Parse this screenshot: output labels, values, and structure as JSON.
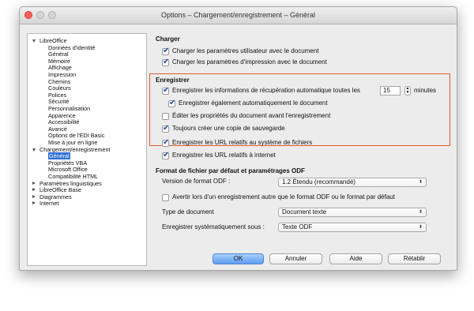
{
  "window": {
    "title": "Options – Chargement/enregistrement – Général"
  },
  "tree": [
    {
      "label": "LibreOffice",
      "level": 0,
      "toggle": "down"
    },
    {
      "label": "Données d'identité",
      "level": 1
    },
    {
      "label": "Général",
      "level": 1
    },
    {
      "label": "Mémoire",
      "level": 1
    },
    {
      "label": "Affichage",
      "level": 1
    },
    {
      "label": "Impression",
      "level": 1
    },
    {
      "label": "Chemins",
      "level": 1
    },
    {
      "label": "Couleurs",
      "level": 1
    },
    {
      "label": "Polices",
      "level": 1
    },
    {
      "label": "Sécurité",
      "level": 1
    },
    {
      "label": "Personnalisation",
      "level": 1
    },
    {
      "label": "Apparence",
      "level": 1
    },
    {
      "label": "Accessibilité",
      "level": 1
    },
    {
      "label": "Avancé",
      "level": 1
    },
    {
      "label": "Options de l'EDI Basic",
      "level": 1
    },
    {
      "label": "Mise à jour en ligne",
      "level": 1
    },
    {
      "label": "Chargement/enregistrement",
      "level": 0,
      "toggle": "down"
    },
    {
      "label": "Général",
      "level": 1,
      "selected": true
    },
    {
      "label": "Propriétés VBA",
      "level": 1
    },
    {
      "label": "Microsoft Office",
      "level": 1
    },
    {
      "label": "Compatibilité HTML",
      "level": 1
    },
    {
      "label": "Paramètres linguistiques",
      "level": 0,
      "toggle": "right"
    },
    {
      "label": "LibreOffice Base",
      "level": 0,
      "toggle": "right"
    },
    {
      "label": "Diagrammes",
      "level": 0,
      "toggle": "right"
    },
    {
      "label": "Internet",
      "level": 0,
      "toggle": "right"
    }
  ],
  "charger": {
    "heading": "Charger",
    "user_settings": "Charger les paramètres utilisateur avec le document",
    "print_settings": "Charger les paramètres d'impression avec le document"
  },
  "enregistrer": {
    "heading": "Enregistrer",
    "autorecovery": "Enregistrer les informations de récupération automatique toutes les",
    "minutes_value": "15",
    "minutes_label": "minutes",
    "autosave": "Enregistrer également automatiquement le document",
    "edit_props": "Éditer les propriétés du document avant l'enregistrement",
    "backup": "Toujours créer une copie de sauvegarde",
    "url_fs": "Enregistrer les URL relatifs au système de fichiers",
    "url_inet": "Enregistrer les URL relatifs à internet"
  },
  "format": {
    "heading": "Format de fichier par défaut et paramétrages ODF",
    "odf_version_label": "Version de format ODF :",
    "odf_version_value": "1.2 Étendu (recommandé)",
    "warn": "Avertir lors d'un enregistrement autre que le format ODF ou le format par défaut",
    "doc_type_label": "Type de document",
    "doc_type_value": "Document texte",
    "save_as_label": "Enregistrer systématiquement sous :",
    "save_as_value": "Texte ODF"
  },
  "buttons": {
    "ok": "OK",
    "cancel": "Annuler",
    "help": "Aide",
    "reset": "Rétablir"
  }
}
